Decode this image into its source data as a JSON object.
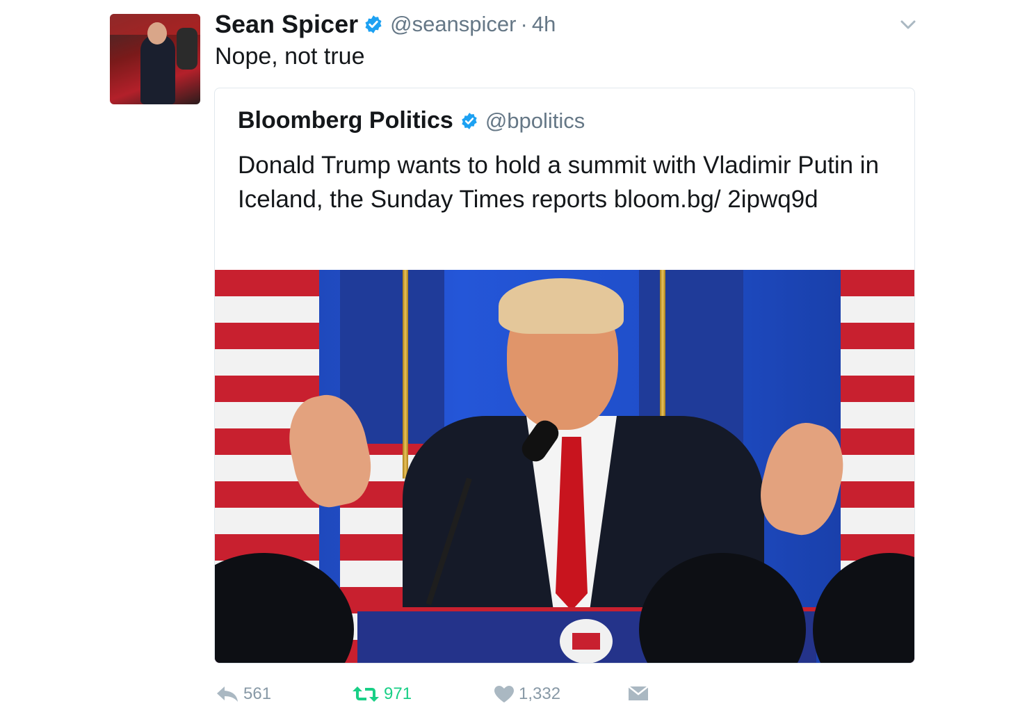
{
  "tweet": {
    "author_name": "Sean Spicer",
    "handle": "@seanspicer",
    "separator": "·",
    "time": "4h",
    "text": "Nope, not true"
  },
  "quoted_tweet": {
    "author_name": "Bloomberg Politics",
    "handle": "@bpolitics",
    "text": "Donald Trump wants to hold a summit with Vladimir Putin in Iceland, the Sunday Times reports bloom.bg/ 2ipwq9d"
  },
  "actions": {
    "reply_count": "561",
    "retweet_count": "971",
    "like_count": "1,332"
  },
  "colors": {
    "verified": "#1da1f2",
    "secondary_text": "#657786",
    "retweet_active": "#19cf86",
    "action_gray": "#aab8c2"
  },
  "icons": [
    "verified-badge-icon",
    "chevron-down-icon",
    "reply-icon",
    "retweet-icon",
    "heart-icon",
    "message-icon"
  ]
}
